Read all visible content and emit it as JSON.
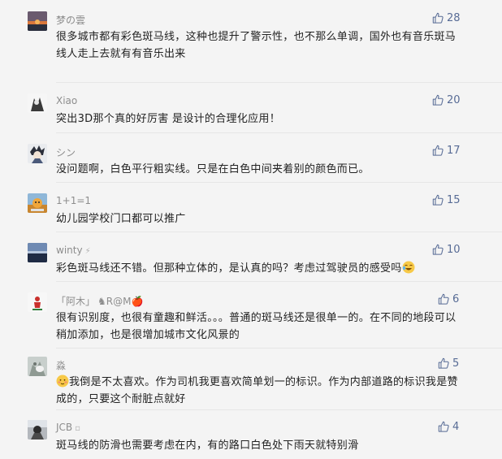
{
  "comments": [
    {
      "name": "梦の雲",
      "suffix": "",
      "likes": "28",
      "text": "很多城市都有彩色斑马线，这种也提升了警示性，也不那么单调，国外也有音乐斑马线人走上去就有有音乐出来"
    },
    {
      "name": "Xiao",
      "suffix": "",
      "likes": "20",
      "text": "突出3D那个真的好厉害 是设计的合理化应用！"
    },
    {
      "name": "シン",
      "suffix": "",
      "likes": "17",
      "text": "没问题啊，白色平行粗实线。只是在白色中间夹着别的颜色而已。"
    },
    {
      "name": "1+1=1",
      "suffix": "",
      "likes": "15",
      "text": "幼儿园学校门口都可以推广"
    },
    {
      "name": "winty",
      "suffix": "⚡",
      "likes": "10",
      "text": "彩色斑马线还不错。但那种立体的，是认真的吗？考虑过驾驶员的感受吗"
    },
    {
      "name": "「阿木」",
      "suffix": "♞R@M🍎",
      "likes": "6",
      "text": "很有识别度，也很有童趣和鲜活。。。普通的斑马线还是很单一的。在不同的地段可以稍加添加，也是很增加城市文化风景的"
    },
    {
      "name": "淼",
      "suffix": "",
      "likes": "5",
      "text": "我倒是不太喜欢。作为司机我更喜欢简单划一的标识。作为内部道路的标识我是赞成的，只要这个耐脏点就好"
    },
    {
      "name": "JCB",
      "suffix": "▫",
      "likes": "4",
      "text": "斑马线的防滑也需要考虑在内，有的路口白色处下雨天就特别滑"
    }
  ],
  "colors": {
    "link": "#576b95",
    "name": "#8d8d8d",
    "text": "#222222",
    "background": "#f4f4f4"
  },
  "icons": {
    "like": "thumbs-up-icon",
    "emoji_laugh": "laughing-emoji-icon",
    "emoji_blush": "blushing-emoji-icon"
  }
}
